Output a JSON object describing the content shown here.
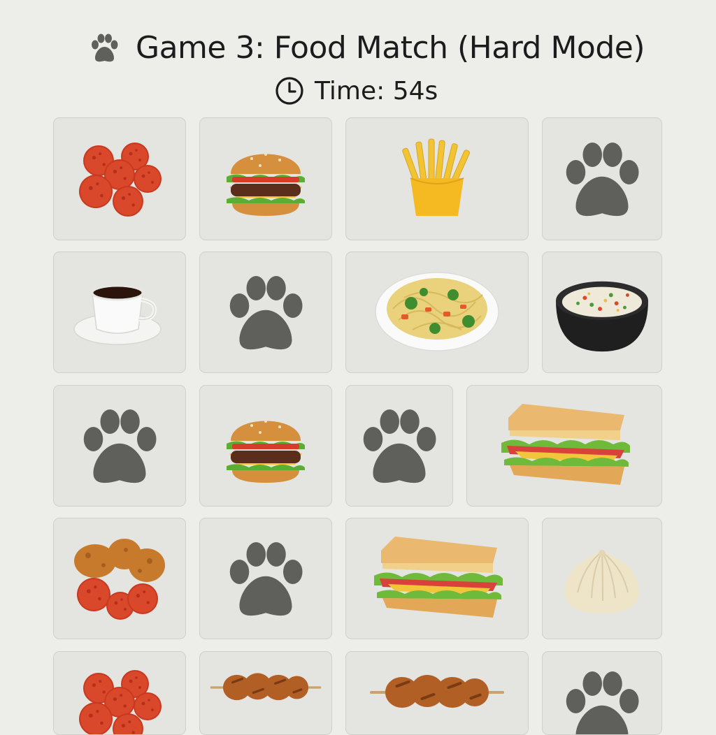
{
  "header": {
    "title": "Game 3: Food Match (Hard Mode)",
    "timer_prefix": "Time: ",
    "timer_value": "54s"
  },
  "colors": {
    "background": "#ededea",
    "card_face": "#e4e4e1",
    "card_border": "#cfcfcc",
    "paw": "#5f605c"
  },
  "board": {
    "rows": [
      [
        "pepperoni",
        "burger",
        "fries",
        "hidden"
      ],
      [
        "coffee",
        "hidden",
        "noodles",
        "fried-rice"
      ],
      [
        "hidden",
        "burger",
        "hidden",
        "sandwich"
      ],
      [
        "chicken-pepperoni",
        "hidden",
        "sandwich",
        "dumpling"
      ],
      [
        "pepperoni",
        "skewer",
        "skewer",
        "hidden"
      ]
    ]
  }
}
